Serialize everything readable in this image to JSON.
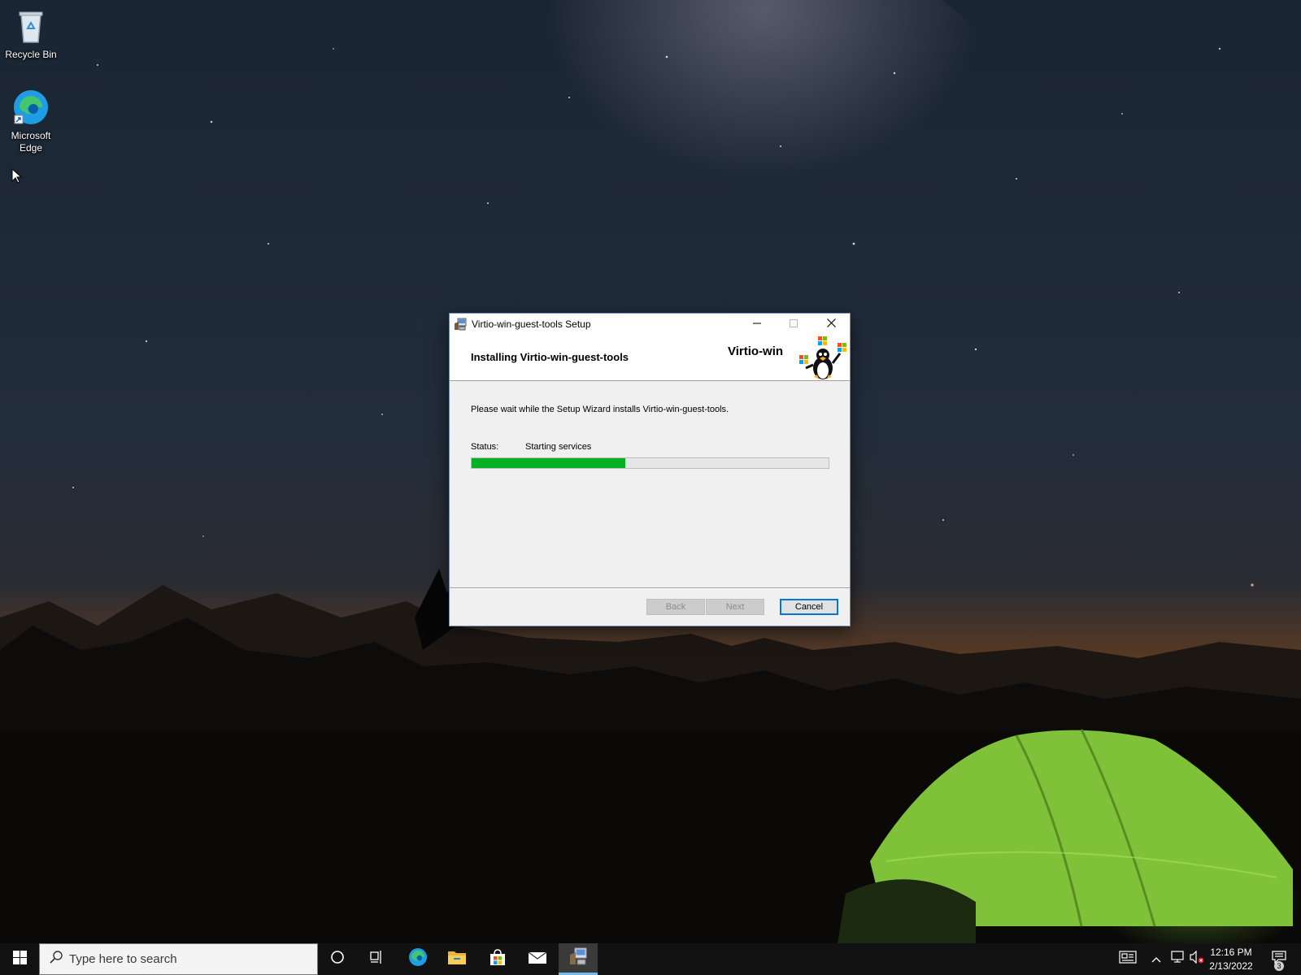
{
  "desktop": {
    "icons": [
      {
        "label": "Recycle Bin"
      },
      {
        "label": "Microsoft Edge"
      }
    ]
  },
  "dialog": {
    "title": "Virtio-win-guest-tools Setup",
    "heading": "Installing Virtio-win-guest-tools",
    "brand": "Virtio-win",
    "message": "Please wait while the Setup Wizard installs Virtio-win-guest-tools.",
    "status_label": "Status:",
    "status_value": "Starting services",
    "progress_fraction": 0.43,
    "buttons": {
      "back": "Back",
      "next": "Next",
      "cancel": "Cancel"
    },
    "accent_color": "#0078d7",
    "progress_color": "#06b025"
  },
  "taskbar": {
    "search_placeholder": "Type here to search",
    "pinned_icons": [
      "start-icon",
      "cortana-icon",
      "task-view-icon",
      "edge-icon",
      "file-explorer-icon",
      "store-icon",
      "mail-icon",
      "setup-app-icon"
    ],
    "tray_icons": [
      "news-icon",
      "chevron-up-icon",
      "network-icon",
      "volume-muted-icon",
      "notifications-icon"
    ],
    "clock_time": "12:16 PM",
    "clock_date": "2/13/2022",
    "notification_count": "3"
  }
}
